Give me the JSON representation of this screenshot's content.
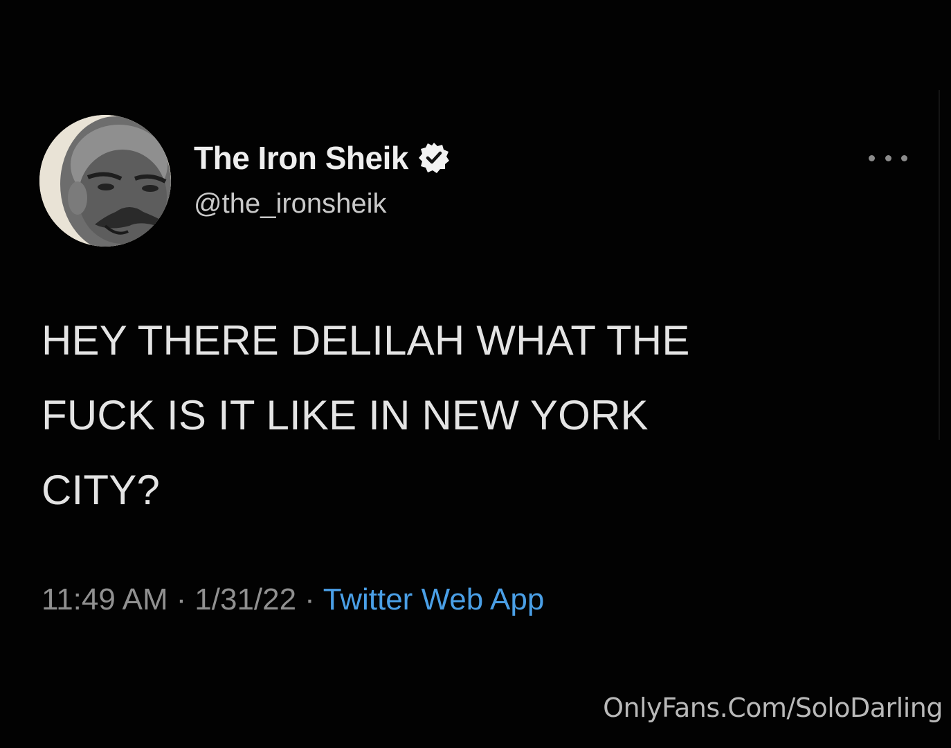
{
  "tweet": {
    "author": {
      "display_name": "The Iron Sheik",
      "handle": "@the_ironsheik",
      "verified": true
    },
    "text_lines": [
      "HEY THERE DELILAH WHAT THE",
      "FUCK IS IT LIKE IN NEW YORK",
      "CITY?"
    ],
    "time": "11:49 AM",
    "date": "1/31/22",
    "separator": "·",
    "source": "Twitter Web App"
  },
  "watermark": "OnlyFans.Com/SoloDarling",
  "icons": {
    "avatar": "profile-photo",
    "verified": "verified-badge-icon",
    "more": "more-options-icon"
  },
  "colors": {
    "background": "#020202",
    "text_primary": "#e4e4e4",
    "text_secondary": "#909090",
    "link": "#4a9fe6"
  }
}
